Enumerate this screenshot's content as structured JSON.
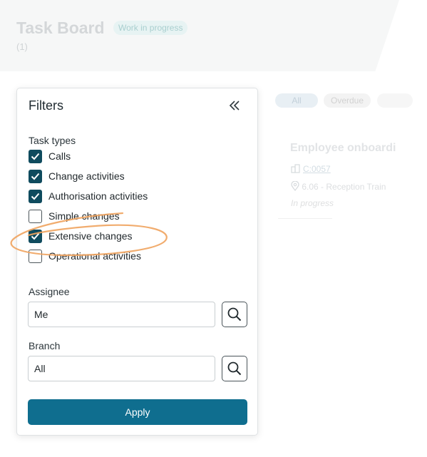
{
  "board": {
    "title": "Task Board",
    "status_badge": "Work in progress",
    "count": "(1)"
  },
  "tabs": [
    {
      "label": "All"
    },
    {
      "label": "Overdue"
    },
    {
      "label": ""
    }
  ],
  "card": {
    "title": "Employee onboardi",
    "ref_id": "C:0057",
    "location": "6.06 - Reception Train",
    "status": "In progress"
  },
  "filters": {
    "title": "Filters",
    "task_types_label": "Task types",
    "task_types": [
      {
        "label": "Calls",
        "checked": true
      },
      {
        "label": "Change activities",
        "checked": true
      },
      {
        "label": "Authorisation activities",
        "checked": true
      },
      {
        "label": "Simple changes",
        "checked": false
      },
      {
        "label": "Extensive changes",
        "checked": true
      },
      {
        "label": "Operational activities",
        "checked": false
      }
    ],
    "assignee_label": "Assignee",
    "assignee_value": "Me",
    "branch_label": "Branch",
    "branch_value": "All",
    "apply_label": "Apply"
  },
  "icons": {
    "collapse": "double-chevron-left-icon",
    "search": "search-icon",
    "building": "building-icon",
    "location": "location-pin-icon",
    "check": "checkmark-icon"
  },
  "colors": {
    "checkbox_checked": "#0f4b5e",
    "apply_button": "#0f6e8f",
    "annotation": "#f0a35e"
  }
}
